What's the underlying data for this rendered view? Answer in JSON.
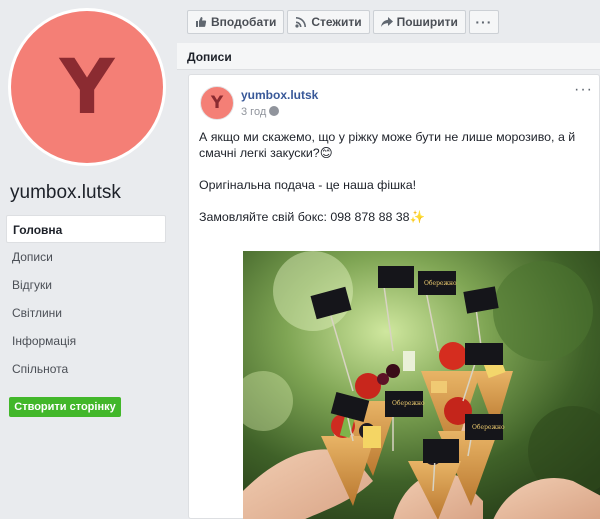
{
  "page": {
    "name": "yumbox.lutsk",
    "avatar_letter": "Y",
    "avatar_color": "#f47f76",
    "avatar_letter_color": "#8b2b31"
  },
  "sidebar": {
    "items": [
      {
        "label": "Головна",
        "active": true
      },
      {
        "label": "Дописи"
      },
      {
        "label": "Відгуки"
      },
      {
        "label": "Світлини"
      },
      {
        "label": "Інформація"
      },
      {
        "label": "Спільнота"
      }
    ],
    "create_page_label": "Створити сторінку"
  },
  "actions": {
    "like_label": "Вподобати",
    "follow_label": "Стежити",
    "share_label": "Поширити",
    "more_icon": "more-horizontal-icon"
  },
  "section": {
    "title": "Дописи"
  },
  "post": {
    "author": "yumbox.lutsk",
    "time": "3 год",
    "lines": [
      "А якщо ми скажемо, що у ріжку може бути не лише морозиво, а й",
      "смачні легкі закуски?😊",
      "Оригінальна подача - це наша фішка!",
      "Замовляйте свій бокс: 098 878 88 38✨"
    ],
    "photo_labels": [
      "Обережно",
      "Обережно",
      "Обережно"
    ]
  },
  "colors": {
    "link": "#385898",
    "create_button": "#42b72a",
    "background": "#e9ebee"
  }
}
